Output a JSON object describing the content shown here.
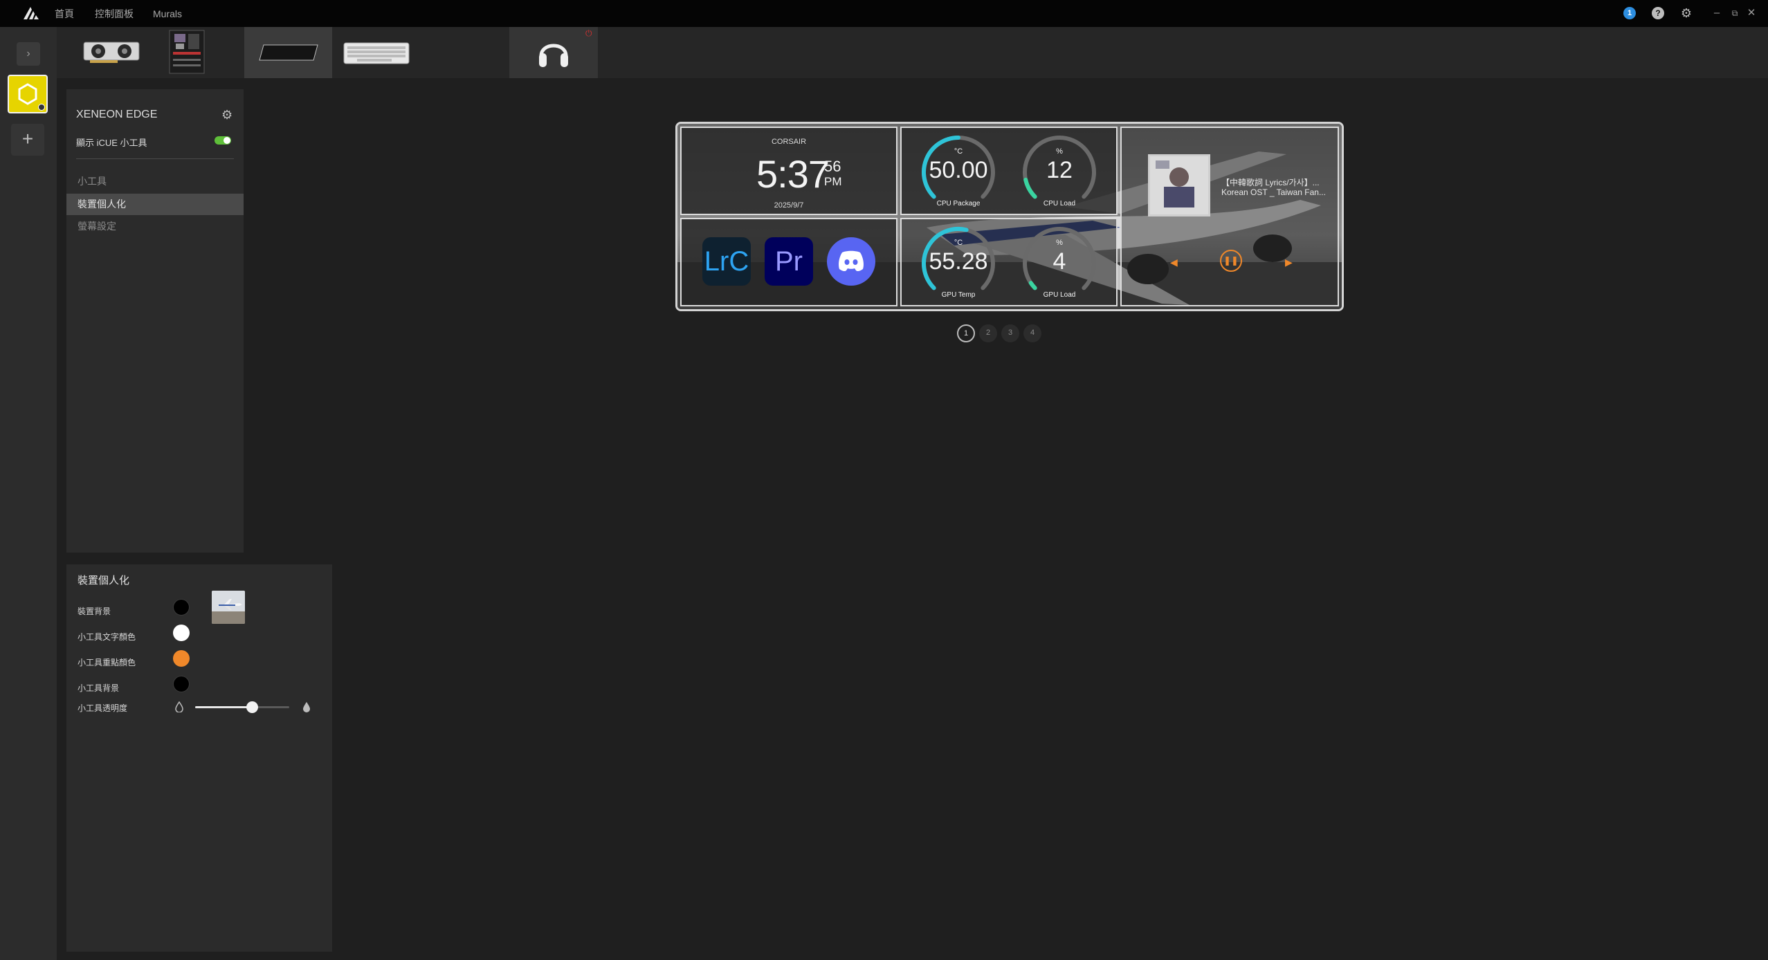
{
  "titlebar": {
    "menu": [
      "首頁",
      "控制面板",
      "Murals"
    ],
    "notification_count": "1",
    "icons": [
      "corsair-logo-icon",
      "notification-icon",
      "help-icon",
      "settings-gear-icon",
      "minimize-icon",
      "restore-icon",
      "close-icon"
    ],
    "window_controls": [
      "–",
      "⧉",
      "✕"
    ]
  },
  "device_strip": {
    "devices": [
      "graphics-card",
      "motherboard",
      "xeneon-edge-display",
      "keyboard",
      "usb-stick",
      "headset"
    ],
    "selected_index": 2
  },
  "settings_panel": {
    "title": "XENEON EDGE",
    "toggle_label": "顯示 iCUE 小工具",
    "toggle_on": true,
    "nav": [
      {
        "label": "小工具",
        "active": false
      },
      {
        "label": "裝置個人化",
        "active": true
      },
      {
        "label": "螢幕設定",
        "active": false
      }
    ]
  },
  "personalization": {
    "title": "裝置個人化",
    "rows": [
      {
        "label": "裝置背景",
        "color": "#000000"
      },
      {
        "label": "小工具文字顏色",
        "color": "#ffffff"
      },
      {
        "label": "小工具重點顏色",
        "color": "#f0882a"
      },
      {
        "label": "小工具背景",
        "color": "#000000"
      }
    ],
    "opacity_label": "小工具透明度",
    "opacity_value": 0.6
  },
  "preview": {
    "clock": {
      "brand": "CORSAIR",
      "time": "5:37",
      "seconds": "56",
      "ampm": "PM",
      "date": "2025/9/7"
    },
    "gauges": [
      {
        "unit": "°C",
        "value": "50.00",
        "label": "CPU Package",
        "fraction": 0.5
      },
      {
        "unit": "%",
        "value": "12",
        "label": "CPU Load",
        "fraction": 0.12
      },
      {
        "unit": "°C",
        "value": "55.28",
        "label": "GPU Temp",
        "fraction": 0.55
      },
      {
        "unit": "%",
        "value": "4",
        "label": "GPU Load",
        "fraction": 0.04
      }
    ],
    "apps": [
      {
        "name": "Lightroom Classic",
        "text": "LrC"
      },
      {
        "name": "Premiere Pro",
        "text": "Pr"
      },
      {
        "name": "Discord",
        "text": ""
      }
    ],
    "music": {
      "line1": "【中韓歌詞 Lyrics/가사】...",
      "line2": "Korean OST _ Taiwan Fan..."
    },
    "pages": [
      "1",
      "2",
      "3",
      "4"
    ],
    "active_page": 0
  }
}
